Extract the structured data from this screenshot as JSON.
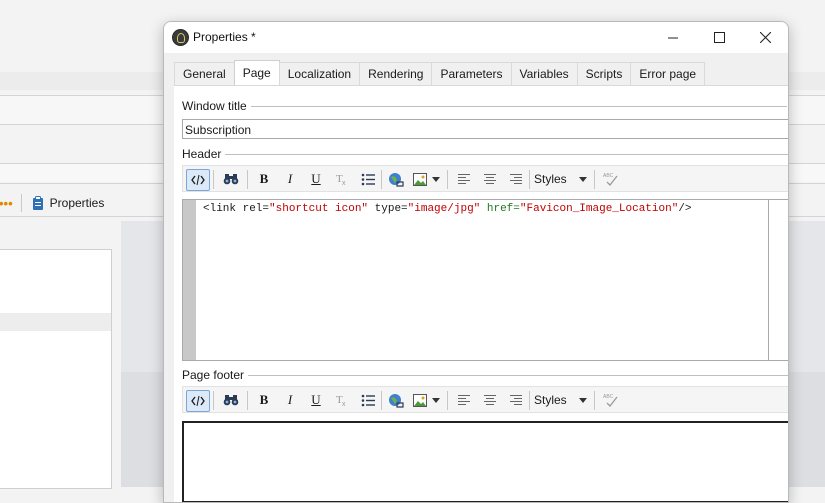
{
  "background": {
    "properties_label": "Properties",
    "dots": "•••"
  },
  "dialog": {
    "title": "Properties *",
    "tabs": [
      {
        "label": "General"
      },
      {
        "label": "Page"
      },
      {
        "label": "Localization"
      },
      {
        "label": "Rendering"
      },
      {
        "label": "Parameters"
      },
      {
        "label": "Variables"
      },
      {
        "label": "Scripts"
      },
      {
        "label": "Error page"
      }
    ],
    "active_tab": "Page",
    "window_title": {
      "label": "Window title",
      "value": "Subscription"
    },
    "header": {
      "label": "Header",
      "code": {
        "tag_open": "<link ",
        "attr1": "rel=",
        "val1": "\"shortcut icon\"",
        "attr2": " type=",
        "val2": "\"image/jpg\"",
        "attr3": " href=",
        "val3": "\"Favicon_Image_Location\"",
        "tag_close": "/>"
      }
    },
    "footer": {
      "label": "Page footer"
    },
    "toolbar": {
      "bold": "B",
      "italic": "I",
      "underline": "U",
      "styles": "Styles",
      "spell": "ABC"
    }
  },
  "colors": {
    "accent": "#7aa7d8",
    "code_string": "#c00000",
    "code_href": "#1f7a1f"
  }
}
